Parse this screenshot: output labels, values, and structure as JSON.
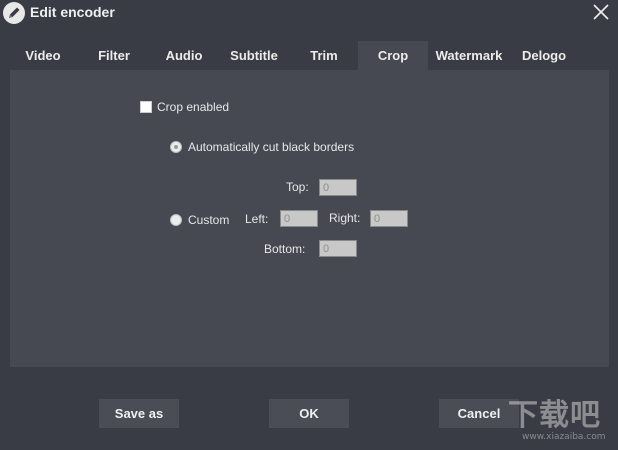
{
  "window": {
    "title": "Edit encoder",
    "icon": "pencil-icon",
    "close_icon": "close-icon"
  },
  "tabs": [
    {
      "label": "Video",
      "active": false
    },
    {
      "label": "Filter",
      "active": false
    },
    {
      "label": "Audio",
      "active": false
    },
    {
      "label": "Subtitle",
      "active": false
    },
    {
      "label": "Trim",
      "active": false
    },
    {
      "label": "Crop",
      "active": true
    },
    {
      "label": "Watermark",
      "active": false
    },
    {
      "label": "Delogo",
      "active": false
    }
  ],
  "crop": {
    "enabled_label": "Crop enabled",
    "enabled": false,
    "auto_label": "Automatically cut black borders",
    "auto_selected": true,
    "custom_label": "Custom",
    "custom_selected": false,
    "top_label": "Top:",
    "top_value": "0",
    "left_label": "Left:",
    "left_value": "0",
    "right_label": "Right:",
    "right_value": "0",
    "bottom_label": "Bottom:",
    "bottom_value": "0"
  },
  "footer": {
    "save_as_label": "Save as",
    "ok_label": "OK",
    "cancel_label": "Cancel"
  },
  "watermark": {
    "text": "下载吧",
    "url": "www.xiazaiba.com"
  },
  "colors": {
    "background": "#3a3c45",
    "panel": "#464852",
    "button": "#4a4c56",
    "text": "#e8e8e8"
  }
}
